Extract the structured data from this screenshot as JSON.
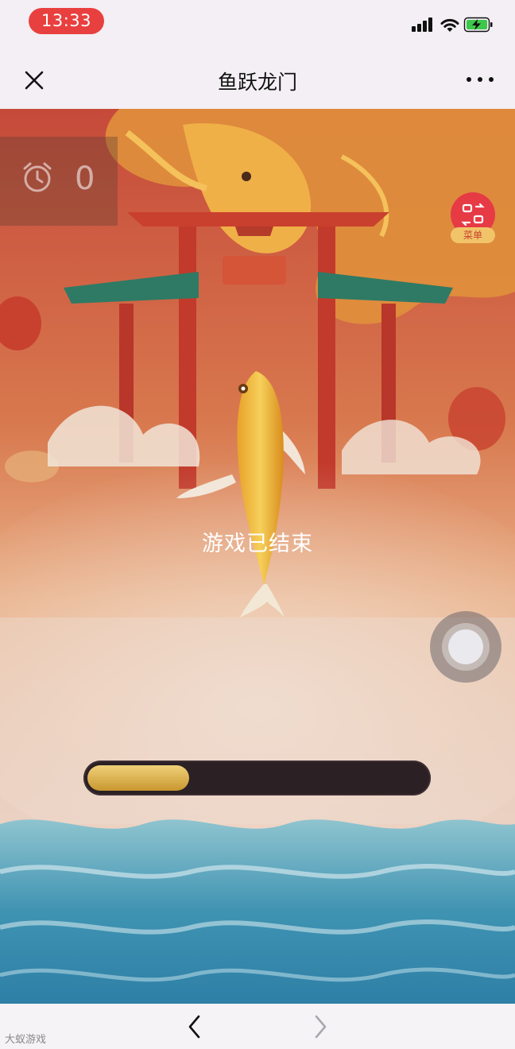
{
  "status_bar": {
    "time": "13:33",
    "icons": [
      "cellular-signal-icon",
      "wifi-icon",
      "battery-charging-icon"
    ],
    "time_pill_color": "#e8403f",
    "battery_color": "#3cc84a"
  },
  "nav": {
    "title": "鱼跃龙门",
    "left_icon": "close-icon",
    "right_icon": "more-icon"
  },
  "game": {
    "timer_icon": "alarm-clock-icon",
    "timer_count": "0",
    "menu_label": "菜单",
    "menu_icon": "switch-icon",
    "status_text": "游戏已结束",
    "progress_fraction": 0.3,
    "progress_color": "#d9ae4a"
  },
  "bottom_bar": {
    "back_icon": "chevron-left-icon",
    "forward_icon": "chevron-right-icon",
    "watermark": "大蚁游戏"
  }
}
